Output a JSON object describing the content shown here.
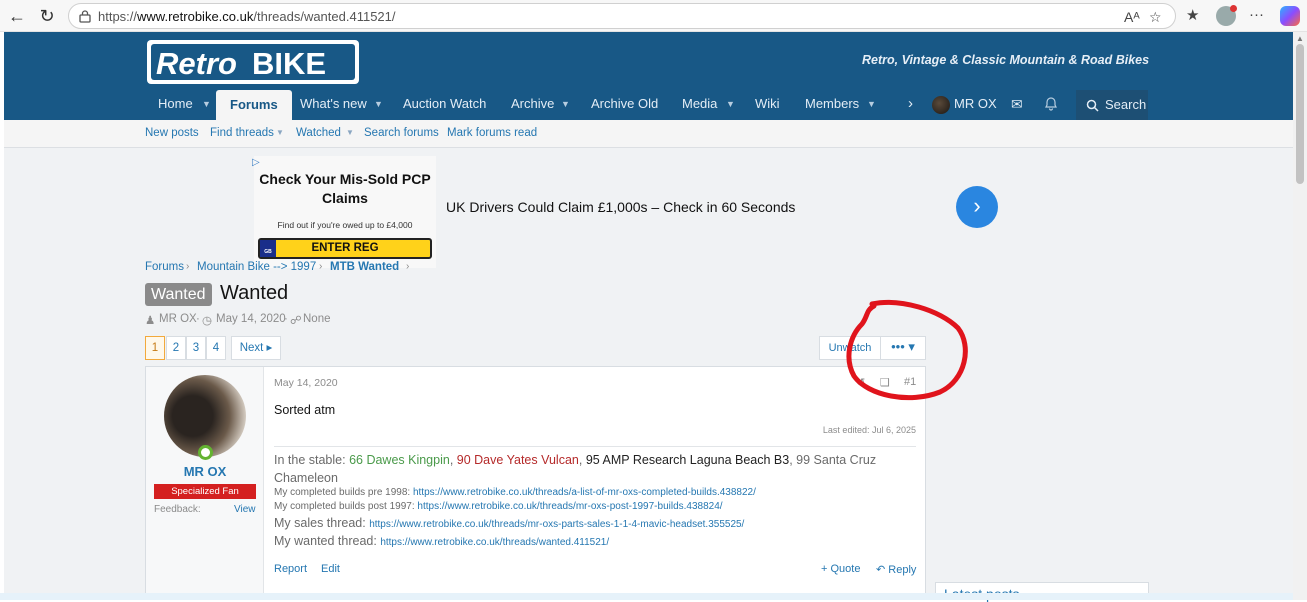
{
  "browser": {
    "url_prefix": "https://",
    "url_domain": "www.retrobike.co.uk",
    "url_path": "/threads/wanted.411521/",
    "read_aloud_label": "Aᴬ",
    "icons": [
      "back-icon",
      "refresh-icon",
      "lock-icon",
      "read-aloud-icon",
      "favorite-star-icon",
      "favorites-icon",
      "profile-icon",
      "more-icon",
      "copilot-icon"
    ]
  },
  "site": {
    "logo_text_a": "Retro",
    "logo_text_b": "BIKE",
    "tagline": "Retro, Vintage & Classic Mountain & Road Bikes",
    "nav": [
      "Home",
      "Forums",
      "What's new",
      "Auction Watch",
      "Archive",
      "Archive Old",
      "Media",
      "Wiki",
      "Members"
    ],
    "user": "MR OX",
    "search_label": "Search",
    "subnav": [
      "New posts",
      "Find threads",
      "Watched",
      "Search forums",
      "Mark forums read"
    ]
  },
  "ad": {
    "title": "Check Your Mis-Sold PCP Claims",
    "subtitle": "Find out if you're owed up to £4,000",
    "cta": "ENTER REG",
    "plate_country": "GB",
    "headline": "UK Drivers Could Claim £1,000s – Check in 60 Seconds"
  },
  "breadcrumb": [
    "Forums",
    "Mountain Bike --> 1997",
    "MTB Wanted"
  ],
  "thread": {
    "prefix": "Wanted",
    "title": "Wanted",
    "author": "MR OX",
    "date": "May 14, 2020",
    "tags": "None",
    "pages": [
      "1",
      "2",
      "3",
      "4"
    ],
    "next_label": "Next",
    "unwatch_label": "Unwatch",
    "more_label": "••• ▾"
  },
  "post": {
    "user": "MR OX",
    "user_title": "Specialized Fan",
    "feedback_label": "Feedback:",
    "feedback_link": "View",
    "date": "May 14, 2020",
    "number": "#1",
    "text": "Sorted atm",
    "last_edited": "Last edited: Jul 6, 2025",
    "sig_prefix": "In the stable: ",
    "sig_bike1": "66 Dawes Kingpin",
    "sig_bike2": "90 Dave Yates Vulcan",
    "sig_bike3": "95 AMP Research Laguna Beach B3",
    "sig_bike4": "99 Santa Cruz Chameleon",
    "sig_sep": ", ",
    "sig_rows": [
      {
        "label": "My completed builds pre 1998: ",
        "link": "https://www.retrobike.co.uk/threads/a-list-of-mr-oxs-completed-builds.438822/"
      },
      {
        "label": "My completed builds post 1997: ",
        "link": "https://www.retrobike.co.uk/threads/mr-oxs-post-1997-builds.438824/"
      },
      {
        "label": "My sales thread: ",
        "link": "https://www.retrobike.co.uk/threads/mr-oxs-parts-sales-1-1-4-mavic-headset.355525/"
      },
      {
        "label": "My wanted thread: ",
        "link": "https://www.retrobike.co.uk/threads/wanted.411521/"
      }
    ],
    "report_label": "Report",
    "edit_label": "Edit",
    "quote_label": "+ Quote",
    "reply_label": "↶ Reply"
  },
  "sidebar": {
    "latest_posts": "Latest posts"
  },
  "colors": {
    "header": "#185886",
    "link": "#2577b1",
    "annotation": "#e0141c",
    "badge": "#d42020"
  }
}
